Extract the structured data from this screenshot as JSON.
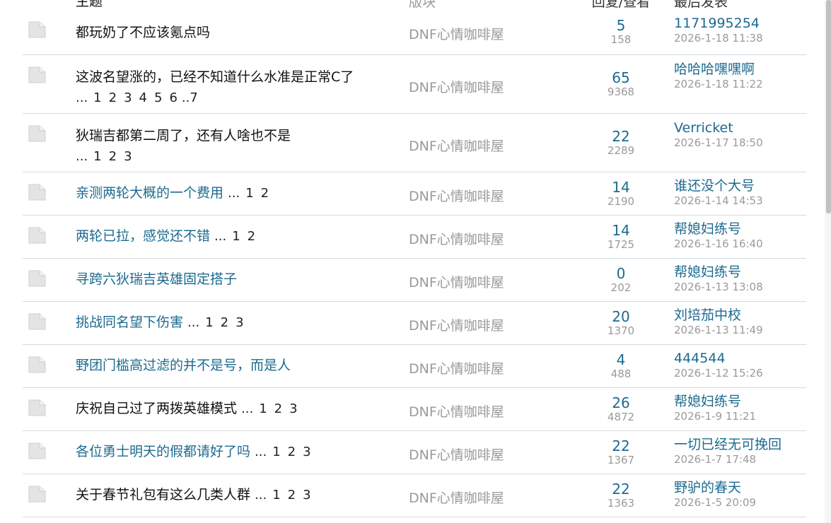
{
  "header": {
    "topic_label": "主题",
    "board_label": "版块",
    "stats_label": "回复/查看",
    "last_label": "最后发表"
  },
  "colors": {
    "link": "#1c6a8f",
    "text": "#111111",
    "muted": "#9a9a9a",
    "divider": "#cfdce6"
  },
  "threads": [
    {
      "title": "都玩奶了不应该氪点吗",
      "is_link": false,
      "pages": [],
      "board": "DNF心情咖啡屋",
      "replies": "5",
      "views": "158",
      "last_user": "1171995254",
      "last_time": "2026-1-18 11:38"
    },
    {
      "title": "这波名望涨的，已经不知道什么水准是正常C了",
      "is_link": false,
      "pages": [
        "...",
        "1",
        "2",
        "3",
        "4",
        "5",
        "6",
        "..7"
      ],
      "board": "DNF心情咖啡屋",
      "replies": "65",
      "views": "9368",
      "last_user": "哈哈哈嘿嘿啊",
      "last_time": "2026-1-18 11:22"
    },
    {
      "title": "狄瑞吉都第二周了，还有人啥也不是",
      "is_link": false,
      "pages": [
        "...",
        "1",
        "2",
        "3"
      ],
      "board": "DNF心情咖啡屋",
      "replies": "22",
      "views": "2289",
      "last_user": "Verricket",
      "last_time": "2026-1-17 18:50"
    },
    {
      "title": "亲测两轮大概的一个费用",
      "is_link": true,
      "pages": [
        "...",
        "1",
        "2"
      ],
      "board": "DNF心情咖啡屋",
      "replies": "14",
      "views": "2190",
      "last_user": "谁还没个大号",
      "last_time": "2026-1-14 14:53"
    },
    {
      "title": "两轮已拉，感觉还不错",
      "is_link": true,
      "pages": [
        "...",
        "1",
        "2"
      ],
      "board": "DNF心情咖啡屋",
      "replies": "14",
      "views": "1725",
      "last_user": "帮媳妇练号",
      "last_time": "2026-1-16 16:40"
    },
    {
      "title": "寻跨六狄瑞吉英雄固定搭子",
      "is_link": true,
      "pages": [],
      "board": "DNF心情咖啡屋",
      "replies": "0",
      "views": "202",
      "last_user": "帮媳妇练号",
      "last_time": "2026-1-13 13:08"
    },
    {
      "title": "挑战同名望下伤害",
      "is_link": true,
      "pages": [
        "...",
        "1",
        "2",
        "3"
      ],
      "board": "DNF心情咖啡屋",
      "replies": "20",
      "views": "1370",
      "last_user": "刘培茄中校",
      "last_time": "2026-1-13 11:49"
    },
    {
      "title": "野团门槛高过滤的并不是号，而是人",
      "is_link": true,
      "pages": [],
      "board": "DNF心情咖啡屋",
      "replies": "4",
      "views": "488",
      "last_user": "444544",
      "last_time": "2026-1-12 15:26"
    },
    {
      "title": "庆祝自己过了两拨英雄模式",
      "is_link": false,
      "pages": [
        "...",
        "1",
        "2",
        "3"
      ],
      "board": "DNF心情咖啡屋",
      "replies": "26",
      "views": "4872",
      "last_user": "帮媳妇练号",
      "last_time": "2026-1-9 11:21"
    },
    {
      "title": "各位勇士明天的假都请好了吗",
      "is_link": true,
      "pages": [
        "...",
        "1",
        "2",
        "3"
      ],
      "board": "DNF心情咖啡屋",
      "replies": "22",
      "views": "1367",
      "last_user": "一切已经无可挽回",
      "last_time": "2026-1-7 17:48"
    },
    {
      "title": "关于春节礼包有这么几类人群",
      "is_link": false,
      "pages": [
        "...",
        "1",
        "2",
        "3"
      ],
      "board": "DNF心情咖啡屋",
      "replies": "22",
      "views": "1363",
      "last_user": "野驴的春天",
      "last_time": "2026-1-5 20:09"
    }
  ]
}
